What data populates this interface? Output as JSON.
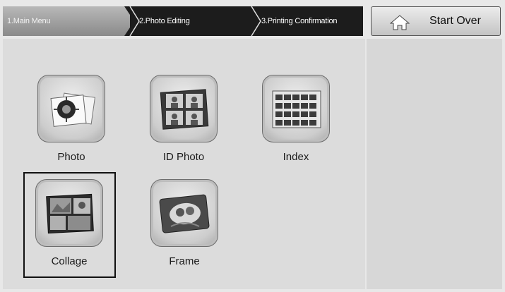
{
  "breadcrumb": {
    "steps": [
      {
        "label": "1.Main Menu",
        "active": true
      },
      {
        "label": "2.Photo Editing",
        "active": false
      },
      {
        "label": "3.Printing Confirmation",
        "active": false
      }
    ]
  },
  "start_over": {
    "label": "Start Over",
    "icon": "home-icon"
  },
  "menu": {
    "items": [
      {
        "label": "Photo",
        "icon": "photo-icon",
        "selected": false
      },
      {
        "label": "ID Photo",
        "icon": "id-photo-icon",
        "selected": false
      },
      {
        "label": "Index",
        "icon": "index-icon",
        "selected": false
      },
      {
        "label": "Collage",
        "icon": "collage-icon",
        "selected": true
      },
      {
        "label": "Frame",
        "icon": "frame-icon",
        "selected": false
      }
    ]
  }
}
